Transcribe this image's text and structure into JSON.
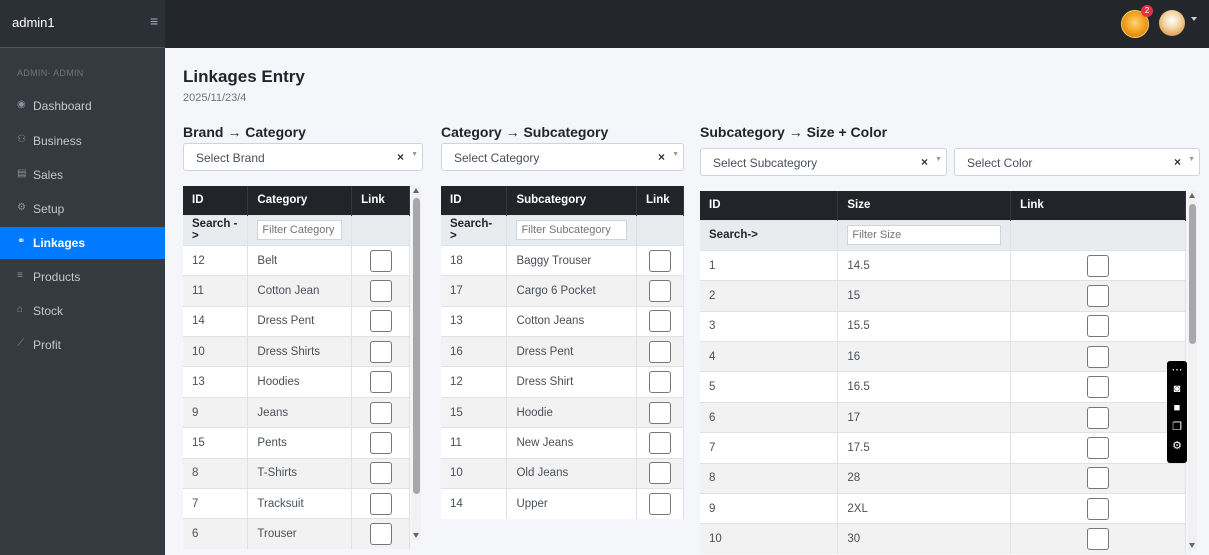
{
  "app": {
    "user": "admin1",
    "role": "ADMIN- ADMIN",
    "notifications": "2"
  },
  "nav": [
    {
      "label": "Dashboard",
      "icon": "dashboard-icon",
      "glyph": "◉"
    },
    {
      "label": "Business",
      "icon": "users-icon",
      "glyph": "⚇"
    },
    {
      "label": "Sales",
      "icon": "cart-icon",
      "glyph": "▤"
    },
    {
      "label": "Setup",
      "icon": "gears-icon",
      "glyph": "⚙"
    },
    {
      "label": "Linkages",
      "icon": "link-icon",
      "glyph": "⚭"
    },
    {
      "label": "Products",
      "icon": "list-icon",
      "glyph": "≡"
    },
    {
      "label": "Stock",
      "icon": "warehouse-icon",
      "glyph": "⌂"
    },
    {
      "label": "Profit",
      "icon": "chart-icon",
      "glyph": "⟋"
    }
  ],
  "page": {
    "title": "Linkages Entry",
    "date": "2025/11/23/4"
  },
  "brand_category": {
    "heading": "Brand → Category",
    "select": "Select Brand",
    "columns": [
      "ID",
      "Category",
      "Link"
    ],
    "search_label": "Search ->",
    "filter_placeholder": "Filter Category",
    "rows": [
      {
        "id": "12",
        "name": "Belt"
      },
      {
        "id": "11",
        "name": "Cotton Jean"
      },
      {
        "id": "14",
        "name": "Dress Pent"
      },
      {
        "id": "10",
        "name": "Dress Shirts"
      },
      {
        "id": "13",
        "name": "Hoodies"
      },
      {
        "id": "9",
        "name": "Jeans"
      },
      {
        "id": "15",
        "name": "Pents"
      },
      {
        "id": "8",
        "name": "T-Shirts"
      },
      {
        "id": "7",
        "name": "Tracksuit"
      },
      {
        "id": "6",
        "name": "Trouser"
      }
    ]
  },
  "category_subcategory": {
    "heading": "Category → Subcategory",
    "select": "Select Category",
    "columns": [
      "ID",
      "Subcategory",
      "Link"
    ],
    "search_label": "Search->",
    "filter_placeholder": "Filter Subcategory",
    "rows": [
      {
        "id": "18",
        "name": "Baggy Trouser"
      },
      {
        "id": "17",
        "name": "Cargo 6 Pocket"
      },
      {
        "id": "13",
        "name": "Cotton Jeans"
      },
      {
        "id": "16",
        "name": "Dress Pent"
      },
      {
        "id": "12",
        "name": "Dress Shirt"
      },
      {
        "id": "15",
        "name": "Hoodie"
      },
      {
        "id": "11",
        "name": "New Jeans"
      },
      {
        "id": "10",
        "name": "Old Jeans"
      },
      {
        "id": "14",
        "name": "Upper"
      }
    ]
  },
  "subcategory_size": {
    "heading": "Subcategory → Size + Color",
    "select_sub": "Select Subcategory",
    "select_color": "Select Color",
    "columns": [
      "ID",
      "Size",
      "Link"
    ],
    "search_label": "Search->",
    "filter_placeholder": "Filter Size",
    "rows": [
      {
        "id": "1",
        "name": "14.5"
      },
      {
        "id": "2",
        "name": "15"
      },
      {
        "id": "3",
        "name": "15.5"
      },
      {
        "id": "4",
        "name": "16"
      },
      {
        "id": "5",
        "name": "16.5"
      },
      {
        "id": "6",
        "name": "17"
      },
      {
        "id": "7",
        "name": "17.5"
      },
      {
        "id": "8",
        "name": "28"
      },
      {
        "id": "9",
        "name": "2XL"
      },
      {
        "id": "10",
        "name": "30"
      }
    ]
  },
  "glyphs": {
    "hamburger": "≡",
    "clear": "×",
    "dropdown": "▼"
  },
  "float_toolbar": [
    {
      "icon": "more-icon",
      "glyph": "⋯"
    },
    {
      "icon": "camera-icon",
      "glyph": "◙"
    },
    {
      "icon": "video-icon",
      "glyph": "■"
    },
    {
      "icon": "copy-icon",
      "glyph": "❐"
    },
    {
      "icon": "settings-icon",
      "glyph": "⚙"
    }
  ],
  "colors": {
    "sidebar": "#343a40",
    "active": "#007bff",
    "header": "#212529"
  }
}
